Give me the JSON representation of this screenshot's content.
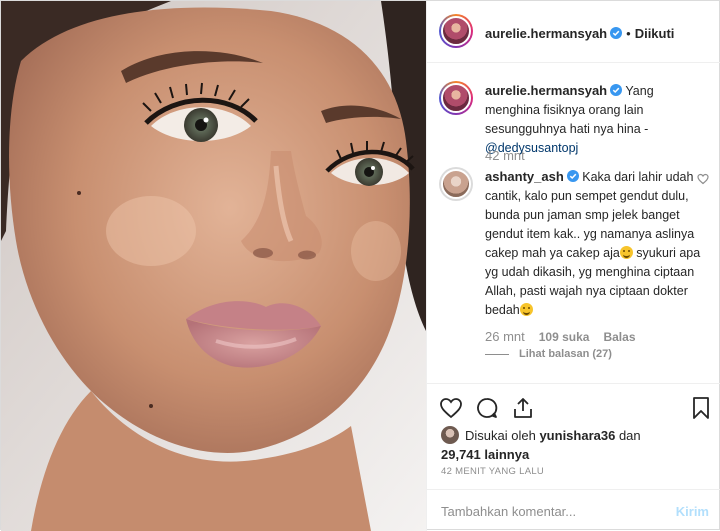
{
  "post": {
    "author": "aurelie.hermansyah",
    "follow_status": "Diikuti",
    "photo_alt": "portrait"
  },
  "caption": {
    "author": "aurelie.hermansyah",
    "text": "Yang menghina fisiknya orang lain sesungguhnya hati nya hina - ",
    "mention": "@dedysusantopj",
    "time": "42 mnt"
  },
  "comment": {
    "author": "ashanty_ash",
    "text_1": "Kaka dari lahir udah cantik, kalo pun sempet gendut dulu, bunda pun jaman smp jelek banget gendut item kak.. yg namanya aslinya cakep mah ya cakep aja",
    "text_2": " syukuri apa yg udah dikasih, yg menghina ciptaan Allah, pasti wajah nya ciptaan dokter bedah",
    "time": "26 mnt",
    "likes": "109 suka",
    "reply": "Balas",
    "view_replies": "Lihat balasan (27)"
  },
  "likes": {
    "prefix": "Disukai oleh",
    "user": "yunishara36",
    "and": "dan",
    "count": "29,741 lainnya"
  },
  "timestamp": "42 MENIT YANG LALU",
  "composer": {
    "placeholder": "Tambahkan komentar...",
    "send": "Kirim"
  },
  "icons": [
    "heart-icon",
    "comment-icon",
    "share-icon",
    "bookmark-icon",
    "verified-icon",
    "emoji-icon"
  ],
  "colors": {
    "verified": "#3897f0",
    "link": "#00376b",
    "muted": "#8e8e8e",
    "send_disabled": "#b2dffc"
  }
}
